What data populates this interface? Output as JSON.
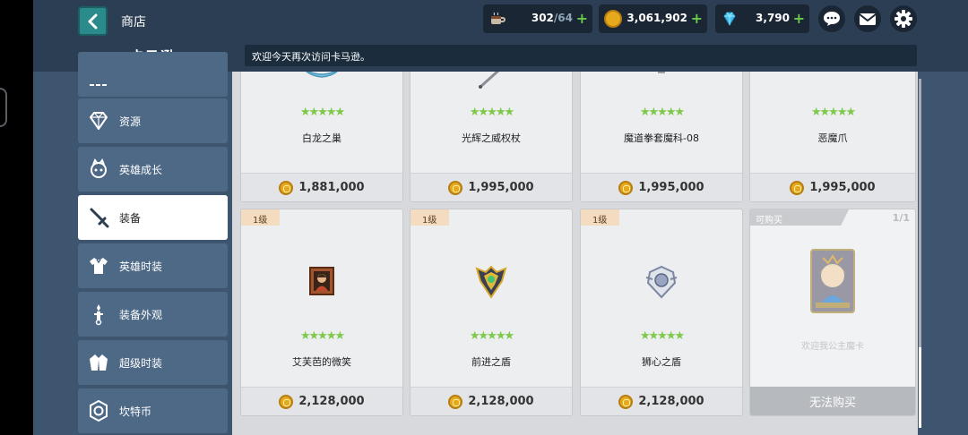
{
  "header": {
    "title": "商店",
    "stamina": {
      "current": "302",
      "max": "/64"
    },
    "gold": "3,061,902",
    "gems": "3,790"
  },
  "shop": {
    "name": "卡马逊",
    "welcome_text": "欢迎今天再次访问卡马逊。"
  },
  "sidebar": {
    "items": [
      {
        "label": "",
        "icon": "grid-icon"
      },
      {
        "label": "资源",
        "icon": "diamond-icon"
      },
      {
        "label": "英雄成长",
        "icon": "hero-growth-icon"
      },
      {
        "label": "装备",
        "icon": "sword-icon",
        "active": true
      },
      {
        "label": "英雄时装",
        "icon": "costume-icon"
      },
      {
        "label": "装备外观",
        "icon": "equipment-appearance-icon"
      },
      {
        "label": "超级时装",
        "icon": "super-costume-icon"
      },
      {
        "label": "坎特币",
        "icon": "kanterbury-coin-icon"
      }
    ]
  },
  "items": [
    {
      "name": "白龙之巢",
      "price": "1,881,000",
      "stars": "★★★★★"
    },
    {
      "name": "光辉之威权杖",
      "price": "1,995,000",
      "stars": "★★★★★"
    },
    {
      "name": "魔道拳套魔科-08",
      "price": "1,995,000",
      "stars": "★★★★★"
    },
    {
      "name": "恶魔爪",
      "price": "1,995,000",
      "stars": "★★★★★"
    },
    {
      "name": "艾芙芭的微笑",
      "price": "2,128,000",
      "stars": "★★★★★",
      "level": "1级"
    },
    {
      "name": "前进之盾",
      "price": "2,128,000",
      "stars": "★★★★★",
      "level": "1级"
    },
    {
      "name": "狮心之盾",
      "price": "2,128,000",
      "stars": "★★★★★",
      "level": "1级"
    },
    {
      "availability": "可购买",
      "stock": "1/1",
      "subtext": "欢迎我公主魔卡",
      "button": "无法购买"
    }
  ],
  "colors": {
    "accent_green": "#7ec84a",
    "coin_gold": "#e6a91e",
    "active_tab_underline": "#e08a2b",
    "topbar_bg": "#2b3e53",
    "sidebar_bg": "#3d556f"
  }
}
